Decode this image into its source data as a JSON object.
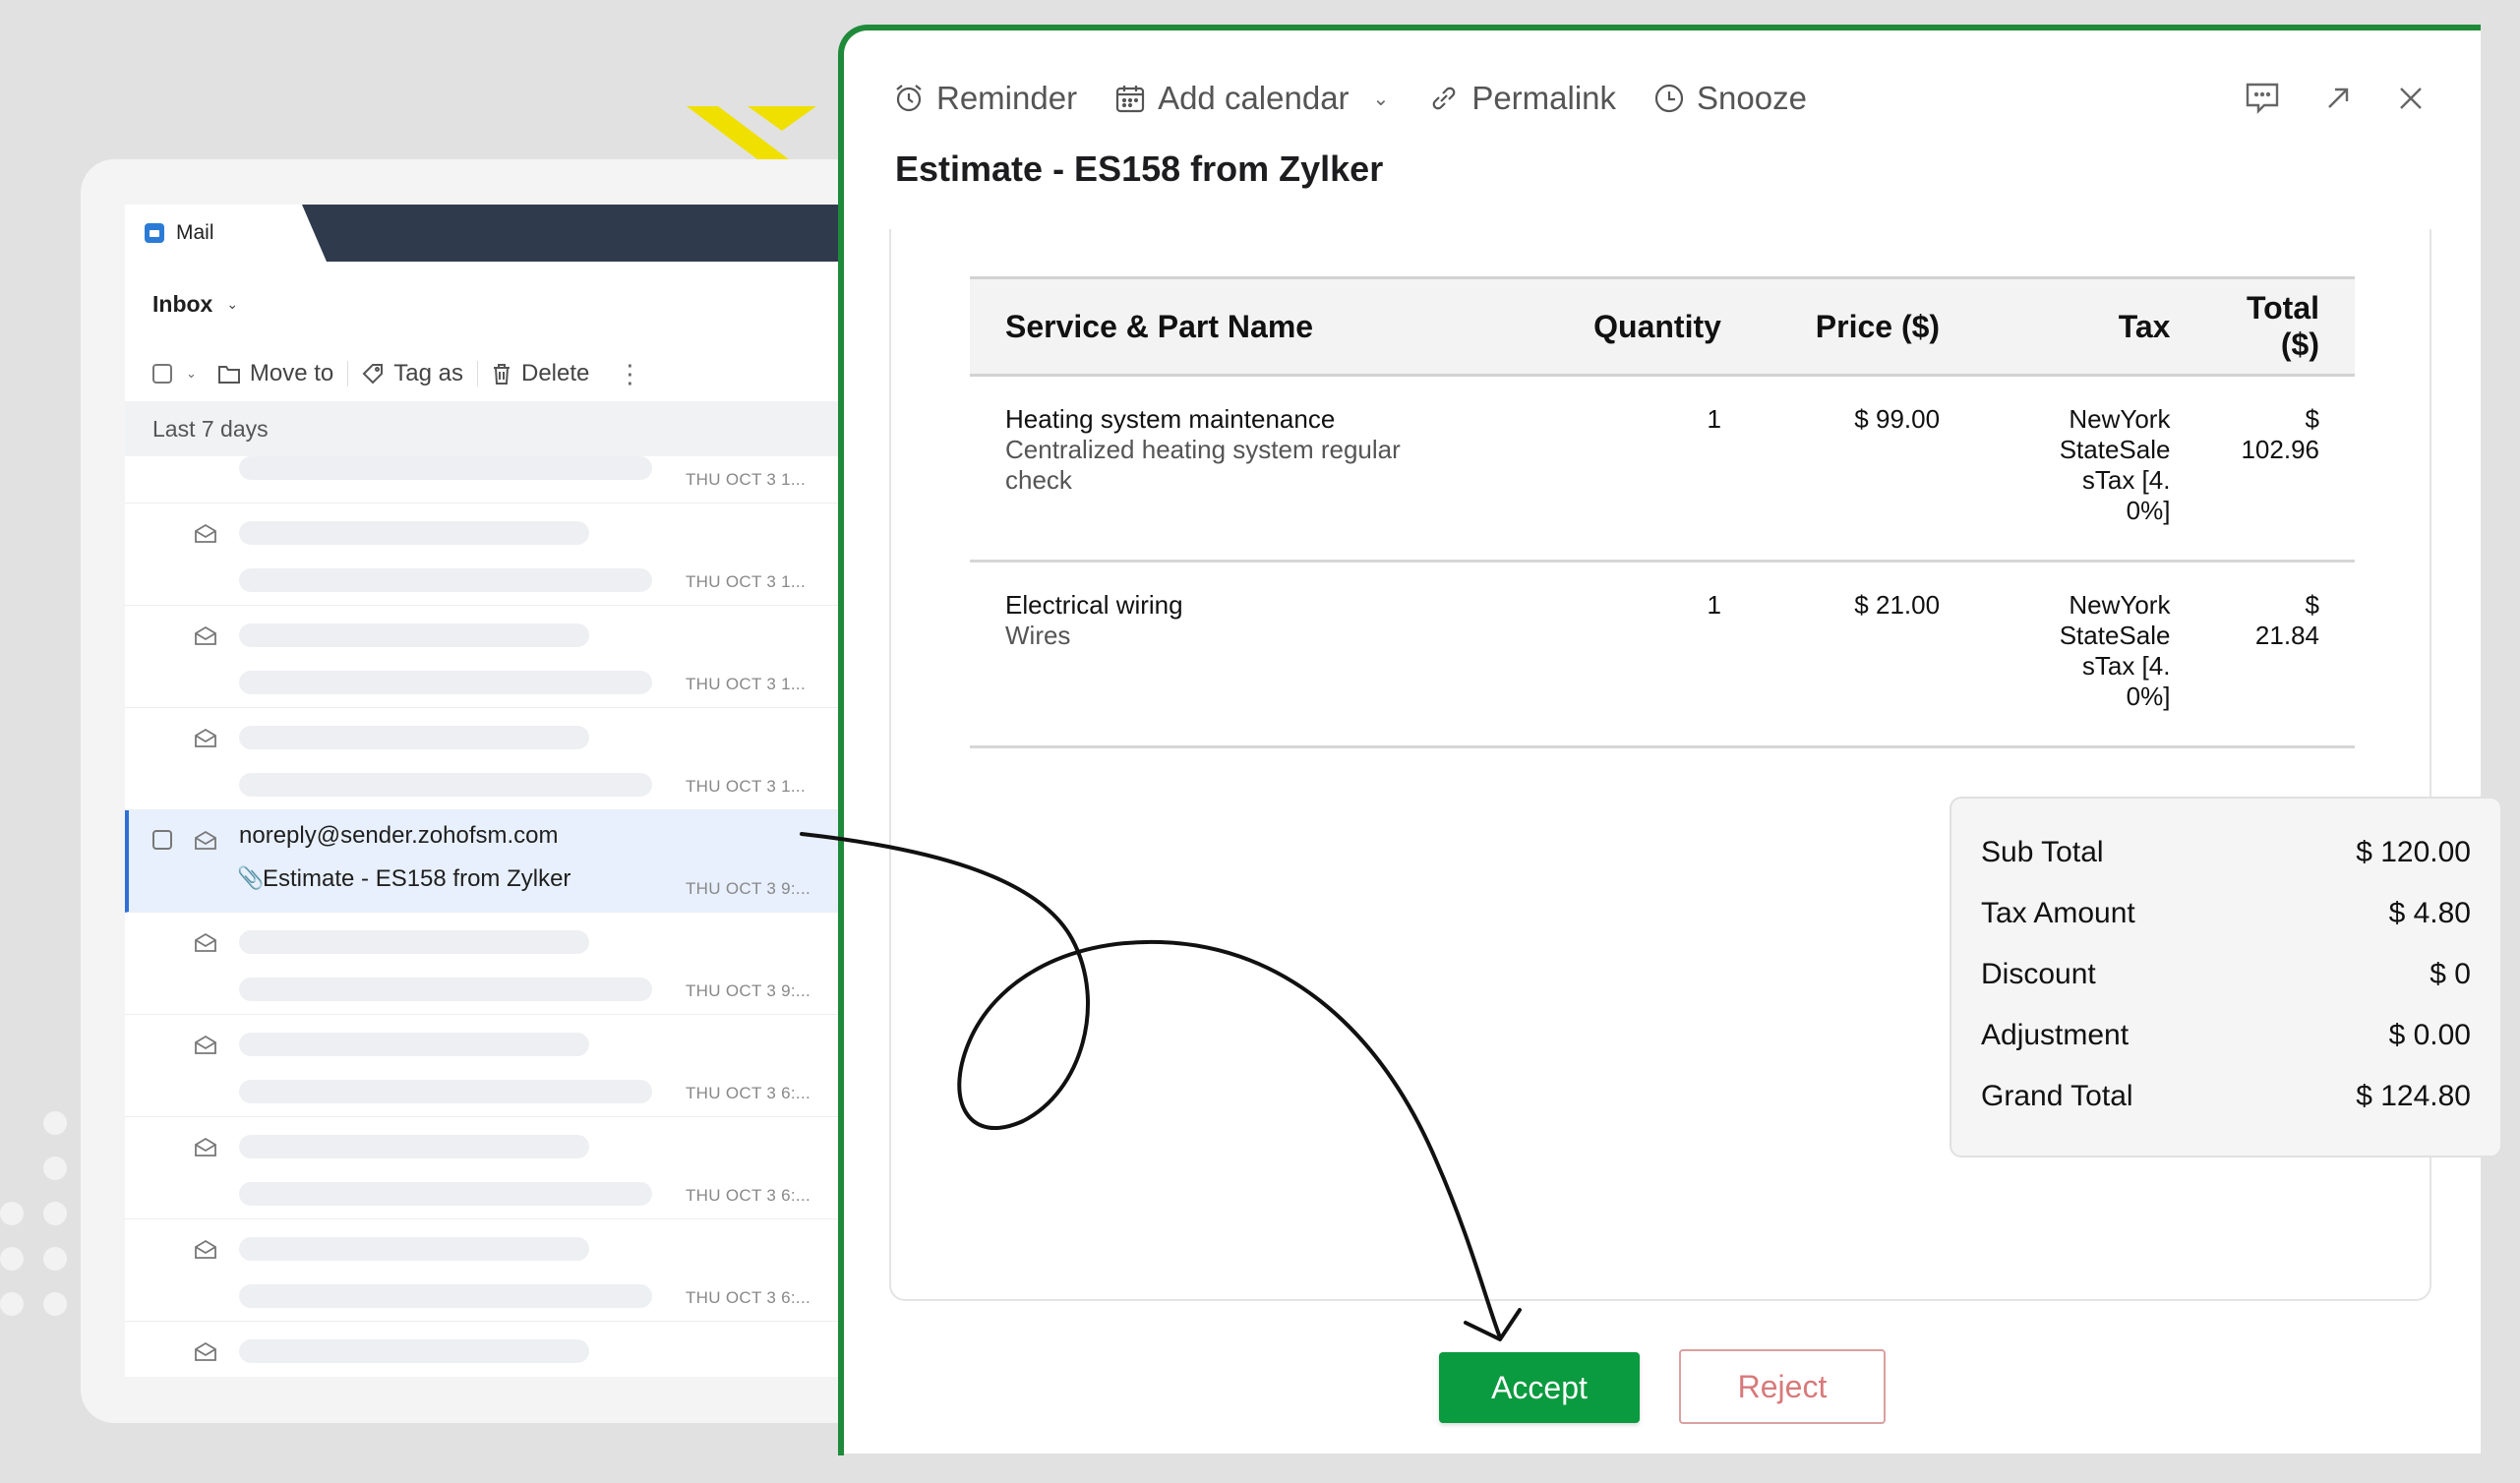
{
  "mail": {
    "tab_label": "Mail",
    "folder": "Inbox",
    "actions": {
      "move_to": "Move to",
      "tag_as": "Tag as",
      "delete": "Delete"
    },
    "section_label": "Last 7 days",
    "rows": [
      {
        "date": "THU OCT 3 1..."
      },
      {
        "date": "THU OCT 3 1..."
      },
      {
        "date": "THU OCT 3 1..."
      },
      {
        "date": "THU OCT 3 1..."
      },
      {
        "sender": "noreply@sender.zohofsm.com",
        "subject": "Estimate - ES158 from Zylker",
        "date": "THU OCT 3 9:..."
      },
      {
        "date": "THU OCT 3 9:..."
      },
      {
        "date": "THU OCT 3 6:..."
      },
      {
        "date": "THU OCT 3 6:..."
      },
      {
        "date": "THU OCT 3 6:..."
      }
    ]
  },
  "modal": {
    "toolbar": {
      "reminder": "Reminder",
      "add_calendar": "Add calendar",
      "permalink": "Permalink",
      "snooze": "Snooze"
    },
    "title": "Estimate - ES158 from Zylker",
    "table": {
      "headers": [
        "Service & Part Name",
        "Quantity",
        "Price ($)",
        "Tax",
        "Total ($)"
      ],
      "rows": [
        {
          "name": "Heating system maintenance",
          "desc": "Centralized heating system regular check",
          "qty": "1",
          "price": "$ 99.00",
          "tax": "NewYorkStateSalesTax [4.0%]",
          "total": "$ 102.96"
        },
        {
          "name": "Electrical wiring",
          "desc": "Wires",
          "qty": "1",
          "price": "$ 21.00",
          "tax": "NewYorkStateSalesTax [4.0%]",
          "total": "$ 21.84"
        }
      ]
    },
    "summary": [
      {
        "label": "Sub Total",
        "value": "$ 120.00"
      },
      {
        "label": "Tax Amount",
        "value": "$ 4.80"
      },
      {
        "label": "Discount",
        "value": "$ 0"
      },
      {
        "label": "Adjustment",
        "value": "$ 0.00"
      },
      {
        "label": "Grand Total",
        "value": "$ 124.80"
      }
    ],
    "accept_label": "Accept",
    "reject_label": "Reject"
  },
  "colors": {
    "accent_green": "#0a9a3f",
    "modal_border": "#1f8a3a",
    "selected_row": "#e8f0fd",
    "reject_text": "#d77a7a"
  },
  "icons": [
    "mail-app-icon",
    "chevron-down-icon",
    "checkbox-icon",
    "folder-icon",
    "tag-icon",
    "trash-icon",
    "more-vertical-icon",
    "envelope-open-icon",
    "attachment-icon",
    "alarm-clock-icon",
    "calendar-icon",
    "link-icon",
    "clock-icon",
    "comment-icon",
    "expand-icon",
    "close-icon"
  ]
}
